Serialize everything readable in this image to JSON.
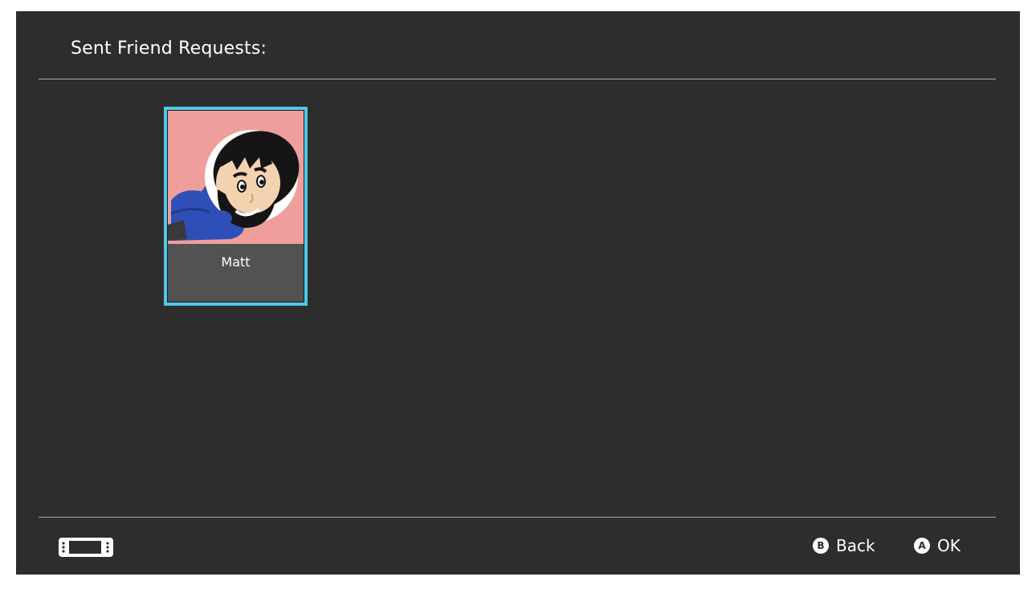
{
  "header": {
    "title": "Sent Friend Requests:"
  },
  "friends": [
    {
      "name": "Matt",
      "avatar_bg_color": "#ef9e9c",
      "selected": true
    }
  ],
  "footer": {
    "console_icon": "switch-handheld-icon",
    "hints": [
      {
        "button": "B",
        "label": "Back"
      },
      {
        "button": "A",
        "label": "OK"
      }
    ]
  },
  "colors": {
    "background": "#2d2d2d",
    "selection_accent": "#4fc8e8",
    "name_plate": "#525252"
  }
}
